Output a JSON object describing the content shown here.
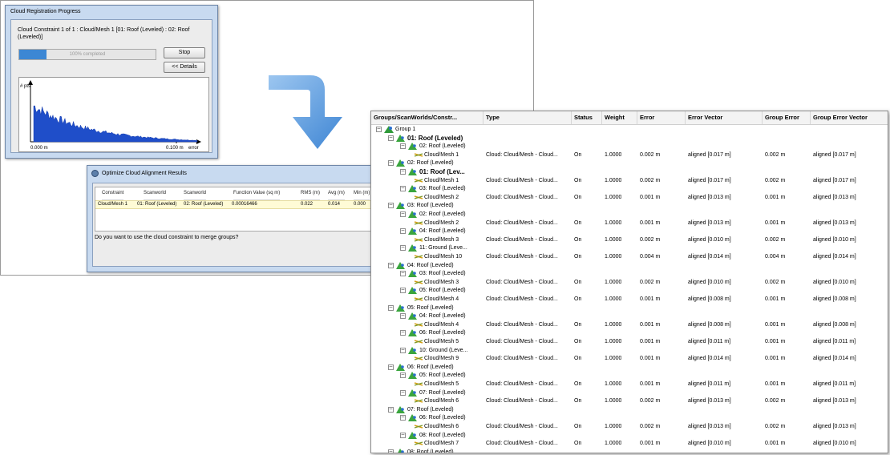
{
  "progress_dialog": {
    "title": "Cloud Registration Progress",
    "message": "Cloud Constraint 1 of 1 : Cloud/Mesh 1 [01: Roof (Leveled) : 02: Roof (Leveled)]",
    "progress_text": "100% completed",
    "progress_fraction": 0.2,
    "stop_label": "Stop",
    "details_label": "<< Details",
    "chart": {
      "y_label": "# pts",
      "x_label": "error",
      "x_min_label": "0.000 m",
      "x_max_label": "0.100 m"
    }
  },
  "optimize_dialog": {
    "title": "Optimize Cloud Alignment Results",
    "columns": [
      "Constraint",
      "Scanworld",
      "Scanworld",
      "Function Value (sq m)",
      "RMS (m)",
      "Avg (m)",
      "Min (m)"
    ],
    "rows": [
      [
        "Cloud/Mesh 1",
        "01: Roof (Leveled)",
        "02: Roof (Leveled)",
        "0.00016466",
        "0.022",
        "0.014",
        "0.000"
      ]
    ],
    "question": "Do you want to use the cloud constraint to merge groups?"
  },
  "arrow": {
    "color": "#4a90d9"
  },
  "grid": {
    "columns": [
      "Groups/ScanWorlds/Constr...",
      "Type",
      "Status",
      "Weight",
      "Error",
      "Error Vector",
      "Group Error",
      "Group Error Vector"
    ],
    "rows": [
      {
        "level": 0,
        "exp": "minus",
        "icon": "group",
        "name": "Group 1"
      },
      {
        "level": 1,
        "exp": "minus",
        "icon": "scanworld",
        "name": "01: Roof (Leveled)",
        "bold": true
      },
      {
        "level": 2,
        "exp": "minus",
        "icon": "scanworld",
        "name": "02: Roof (Leveled)"
      },
      {
        "level": 3,
        "icon": "constraint",
        "name": "Cloud/Mesh 1",
        "type": "Cloud: Cloud/Mesh - Cloud...",
        "status": "On",
        "weight": "1.0000",
        "error": "0.002 m",
        "vector": "aligned [0.017 m]",
        "gerror": "0.002 m",
        "gvector": "aligned [0.017 m]"
      },
      {
        "level": 1,
        "exp": "minus",
        "icon": "scanworld",
        "name": "02: Roof (Leveled)"
      },
      {
        "level": 2,
        "exp": "minus",
        "icon": "scanworld",
        "name": "01: Roof (Lev...",
        "bold": true
      },
      {
        "level": 3,
        "icon": "constraint",
        "name": "Cloud/Mesh 1",
        "type": "Cloud: Cloud/Mesh - Cloud...",
        "status": "On",
        "weight": "1.0000",
        "error": "0.002 m",
        "vector": "aligned [0.017 m]",
        "gerror": "0.002 m",
        "gvector": "aligned [0.017 m]"
      },
      {
        "level": 2,
        "exp": "minus",
        "icon": "scanworld",
        "name": "03: Roof (Leveled)"
      },
      {
        "level": 3,
        "icon": "constraint",
        "name": "Cloud/Mesh 2",
        "type": "Cloud: Cloud/Mesh - Cloud...",
        "status": "On",
        "weight": "1.0000",
        "error": "0.001 m",
        "vector": "aligned [0.013 m]",
        "gerror": "0.001 m",
        "gvector": "aligned [0.013 m]"
      },
      {
        "level": 1,
        "exp": "minus",
        "icon": "scanworld",
        "name": "03: Roof (Leveled)"
      },
      {
        "level": 2,
        "exp": "minus",
        "icon": "scanworld",
        "name": "02: Roof (Leveled)"
      },
      {
        "level": 3,
        "icon": "constraint",
        "name": "Cloud/Mesh 2",
        "type": "Cloud: Cloud/Mesh - Cloud...",
        "status": "On",
        "weight": "1.0000",
        "error": "0.001 m",
        "vector": "aligned [0.013 m]",
        "gerror": "0.001 m",
        "gvector": "aligned [0.013 m]"
      },
      {
        "level": 2,
        "exp": "minus",
        "icon": "scanworld",
        "name": "04: Roof (Leveled)"
      },
      {
        "level": 3,
        "icon": "constraint",
        "name": "Cloud/Mesh 3",
        "type": "Cloud: Cloud/Mesh - Cloud...",
        "status": "On",
        "weight": "1.0000",
        "error": "0.002 m",
        "vector": "aligned [0.010 m]",
        "gerror": "0.002 m",
        "gvector": "aligned [0.010 m]"
      },
      {
        "level": 2,
        "exp": "minus",
        "icon": "scanworld",
        "name": "11: Ground (Leve..."
      },
      {
        "level": 3,
        "icon": "constraint",
        "name": "Cloud/Mesh 10",
        "type": "Cloud: Cloud/Mesh - Cloud...",
        "status": "On",
        "weight": "1.0000",
        "error": "0.004 m",
        "vector": "aligned [0.014 m]",
        "gerror": "0.004 m",
        "gvector": "aligned [0.014 m]"
      },
      {
        "level": 1,
        "exp": "minus",
        "icon": "scanworld",
        "name": "04: Roof (Leveled)"
      },
      {
        "level": 2,
        "exp": "minus",
        "icon": "scanworld",
        "name": "03: Roof (Leveled)"
      },
      {
        "level": 3,
        "icon": "constraint",
        "name": "Cloud/Mesh 3",
        "type": "Cloud: Cloud/Mesh - Cloud...",
        "status": "On",
        "weight": "1.0000",
        "error": "0.002 m",
        "vector": "aligned [0.010 m]",
        "gerror": "0.002 m",
        "gvector": "aligned [0.010 m]"
      },
      {
        "level": 2,
        "exp": "minus",
        "icon": "scanworld",
        "name": "05: Roof (Leveled)"
      },
      {
        "level": 3,
        "icon": "constraint",
        "name": "Cloud/Mesh 4",
        "type": "Cloud: Cloud/Mesh - Cloud...",
        "status": "On",
        "weight": "1.0000",
        "error": "0.001 m",
        "vector": "aligned [0.008 m]",
        "gerror": "0.001 m",
        "gvector": "aligned [0.008 m]"
      },
      {
        "level": 1,
        "exp": "minus",
        "icon": "scanworld",
        "name": "05: Roof (Leveled)"
      },
      {
        "level": 2,
        "exp": "minus",
        "icon": "scanworld",
        "name": "04: Roof (Leveled)"
      },
      {
        "level": 3,
        "icon": "constraint",
        "name": "Cloud/Mesh 4",
        "type": "Cloud: Cloud/Mesh - Cloud...",
        "status": "On",
        "weight": "1.0000",
        "error": "0.001 m",
        "vector": "aligned [0.008 m]",
        "gerror": "0.001 m",
        "gvector": "aligned [0.008 m]"
      },
      {
        "level": 2,
        "exp": "minus",
        "icon": "scanworld",
        "name": "06: Roof (Leveled)"
      },
      {
        "level": 3,
        "icon": "constraint",
        "name": "Cloud/Mesh 5",
        "type": "Cloud: Cloud/Mesh - Cloud...",
        "status": "On",
        "weight": "1.0000",
        "error": "0.001 m",
        "vector": "aligned [0.011 m]",
        "gerror": "0.001 m",
        "gvector": "aligned [0.011 m]"
      },
      {
        "level": 2,
        "exp": "minus",
        "icon": "scanworld",
        "name": "10: Ground (Leve..."
      },
      {
        "level": 3,
        "icon": "constraint",
        "name": "Cloud/Mesh 9",
        "type": "Cloud: Cloud/Mesh - Cloud...",
        "status": "On",
        "weight": "1.0000",
        "error": "0.001 m",
        "vector": "aligned [0.014 m]",
        "gerror": "0.001 m",
        "gvector": "aligned [0.014 m]"
      },
      {
        "level": 1,
        "exp": "minus",
        "icon": "scanworld",
        "name": "06: Roof (Leveled)"
      },
      {
        "level": 2,
        "exp": "minus",
        "icon": "scanworld",
        "name": "05: Roof (Leveled)"
      },
      {
        "level": 3,
        "icon": "constraint",
        "name": "Cloud/Mesh 5",
        "type": "Cloud: Cloud/Mesh - Cloud...",
        "status": "On",
        "weight": "1.0000",
        "error": "0.001 m",
        "vector": "aligned [0.011 m]",
        "gerror": "0.001 m",
        "gvector": "aligned [0.011 m]"
      },
      {
        "level": 2,
        "exp": "minus",
        "icon": "scanworld",
        "name": "07: Roof (Leveled)"
      },
      {
        "level": 3,
        "icon": "constraint",
        "name": "Cloud/Mesh 6",
        "type": "Cloud: Cloud/Mesh - Cloud...",
        "status": "On",
        "weight": "1.0000",
        "error": "0.002 m",
        "vector": "aligned [0.013 m]",
        "gerror": "0.002 m",
        "gvector": "aligned [0.013 m]"
      },
      {
        "level": 1,
        "exp": "minus",
        "icon": "scanworld",
        "name": "07: Roof (Leveled)"
      },
      {
        "level": 2,
        "exp": "minus",
        "icon": "scanworld",
        "name": "06: Roof (Leveled)"
      },
      {
        "level": 3,
        "icon": "constraint",
        "name": "Cloud/Mesh 6",
        "type": "Cloud: Cloud/Mesh - Cloud...",
        "status": "On",
        "weight": "1.0000",
        "error": "0.002 m",
        "vector": "aligned [0.013 m]",
        "gerror": "0.002 m",
        "gvector": "aligned [0.013 m]"
      },
      {
        "level": 2,
        "exp": "minus",
        "icon": "scanworld",
        "name": "08: Roof (Leveled)"
      },
      {
        "level": 3,
        "icon": "constraint",
        "name": "Cloud/Mesh 7",
        "type": "Cloud: Cloud/Mesh - Cloud...",
        "status": "On",
        "weight": "1.0000",
        "error": "0.001 m",
        "vector": "aligned [0.010 m]",
        "gerror": "0.001 m",
        "gvector": "aligned [0.010 m]"
      },
      {
        "level": 1,
        "exp": "minus",
        "icon": "scanworld",
        "name": "08: Roof (Leveled)"
      }
    ]
  }
}
